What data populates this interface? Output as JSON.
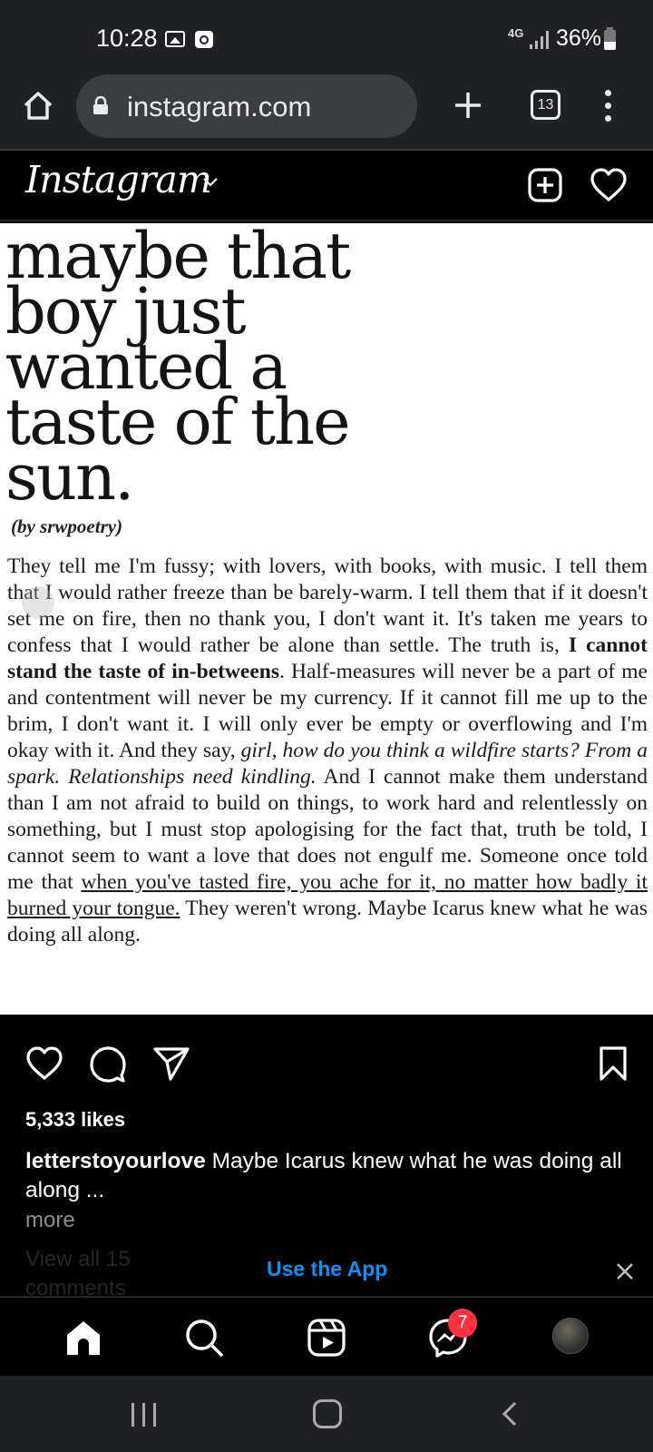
{
  "status_bar": {
    "time": "10:28",
    "network": "4G",
    "battery": "36%"
  },
  "browser": {
    "url": "instagram.com",
    "tab_count": "13"
  },
  "instagram": {
    "logo": "Instagram"
  },
  "post": {
    "image_title": "maybe that\nboy just\nwanted a\ntaste of the\nsun.",
    "image_author": "(by srwpoetry)",
    "image_body": {
      "p1": "They tell me I'm fussy; with lovers, with books, with music. I tell them that I would rather freeze than be barely-warm. I tell them that if it doesn't set me on fire, then no thank you, I don't want it. It's taken me years to confess that I would rather be alone than settle. The truth is, ",
      "bold": "I cannot stand the taste of in-betweens",
      "p2": ". Half-measures will never be a part of me and contentment will never be my currency. If it cannot fill me up to the brim, I don't want it. I will only ever be empty or overflowing and I'm okay with it. And they say, ",
      "italic": "girl, how do you think a wildfire starts? From a spark. Relationships need kindling.",
      "p3": " And I cannot make them understand than I am not afraid to build on things, to work hard and relentlessly on something, but I must stop apologising for the fact that, truth be told, I cannot seem to want a love that does not engulf me. Someone once told me that ",
      "underline": "when you've tasted fire, you ache for it, no matter how badly it burned your tongue.",
      "p4": " They weren't wrong. Maybe Icarus knew what he was doing all along."
    },
    "likes": "5,333 likes",
    "caption_user": "letterstoyourlove",
    "caption_text": " Maybe Icarus knew what he was doing all along ...",
    "more": "more",
    "view_all": "View all 15 comments"
  },
  "banner": {
    "use_app": "Use the App"
  },
  "bottom_nav": {
    "messages_badge": "7"
  },
  "colors": {
    "accent": "#0095f6",
    "badge": "#ff3040"
  }
}
